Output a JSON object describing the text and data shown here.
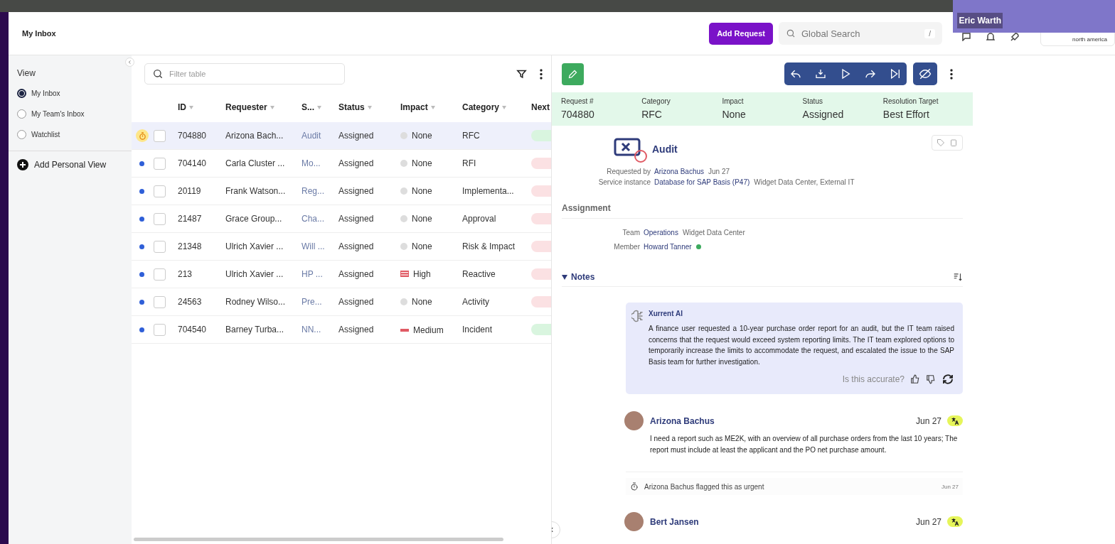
{
  "header": {
    "title": "My Inbox",
    "add_button": "Add Request",
    "search": {
      "placeholder": "Global Search",
      "shortcut": "/"
    },
    "logo_caption": "north america"
  },
  "video_overlay": {
    "name": "Eric Warth"
  },
  "sidebar": {
    "heading": "View",
    "items": [
      {
        "label": "My Inbox",
        "selected": true
      },
      {
        "label": "My Team's Inbox",
        "selected": false
      },
      {
        "label": "Watchlist",
        "selected": false
      }
    ],
    "add_view": "Add Personal View"
  },
  "table": {
    "filter": {
      "placeholder": "Filter table"
    },
    "columns": [
      "ID",
      "Requester",
      "S...",
      "Status",
      "Impact",
      "Category",
      "Next"
    ],
    "rows": [
      {
        "urgent": true,
        "selected": true,
        "id": "704880",
        "requester": "Arizona Bach...",
        "subject": "Audit",
        "status": "Assigned",
        "impact": {
          "kind": "none",
          "label": "None"
        },
        "category": "RFC",
        "color": "#d9f5df"
      },
      {
        "urgent": false,
        "selected": false,
        "id": "704140",
        "requester": "Carla Cluster ...",
        "subject": "Mo...",
        "status": "Assigned",
        "impact": {
          "kind": "none",
          "label": "None"
        },
        "category": "RFI",
        "color": "#fbe1e3"
      },
      {
        "urgent": false,
        "selected": false,
        "id": "20119",
        "requester": "Frank Watson...",
        "subject": "Reg...",
        "status": "Assigned",
        "impact": {
          "kind": "none",
          "label": "None"
        },
        "category": "Implementa...",
        "color": "#fbe1e3"
      },
      {
        "urgent": false,
        "selected": false,
        "id": "21487",
        "requester": "Grace Group...",
        "subject": "Cha...",
        "status": "Assigned",
        "impact": {
          "kind": "none",
          "label": "None"
        },
        "category": "Approval",
        "color": "#fbe1e3"
      },
      {
        "urgent": false,
        "selected": false,
        "id": "21348",
        "requester": "Ulrich Xavier ...",
        "subject": "Will ...",
        "status": "Assigned",
        "impact": {
          "kind": "none",
          "label": "None"
        },
        "category": "Risk & Impact",
        "color": "#fbe1e3"
      },
      {
        "urgent": false,
        "selected": false,
        "id": "213",
        "requester": "Ulrich Xavier ...",
        "subject": "HP ...",
        "status": "Assigned",
        "impact": {
          "kind": "high",
          "label": "High"
        },
        "category": "Reactive",
        "color": "#fbe1e3"
      },
      {
        "urgent": false,
        "selected": false,
        "id": "24563",
        "requester": "Rodney Wilso...",
        "subject": "Pre...",
        "status": "Assigned",
        "impact": {
          "kind": "none",
          "label": "None"
        },
        "category": "Activity",
        "color": "#fbe1e3"
      },
      {
        "urgent": false,
        "selected": false,
        "id": "704540",
        "requester": "Barney Turba...",
        "subject": "NN...",
        "status": "Assigned",
        "impact": {
          "kind": "medium",
          "label": "Medium"
        },
        "category": "Incident",
        "color": "#d9f5df"
      }
    ]
  },
  "detail": {
    "summary": [
      {
        "label": "Request #",
        "value": "704880"
      },
      {
        "label": "Category",
        "value": "RFC"
      },
      {
        "label": "Impact",
        "value": "None"
      },
      {
        "label": "Status",
        "value": "Assigned"
      },
      {
        "label": "Resolution Target",
        "value": "Best Effort"
      }
    ],
    "subject": "Audit",
    "requested_by": {
      "label": "Requested by",
      "name": "Arizona Bachus",
      "date": "Jun 27"
    },
    "service_instance": {
      "label": "Service instance",
      "name": "Database for SAP Basis (P47)",
      "detail": "Widget Data Center, External IT"
    },
    "assignment": {
      "heading": "Assignment",
      "team_label": "Team",
      "team": "Operations",
      "team_detail": "Widget Data Center",
      "member_label": "Member",
      "member": "Howard Tanner",
      "member_online": true
    },
    "notes": {
      "heading": "Notes",
      "expanded": true,
      "ai_summary": {
        "author": "Xurrent AI",
        "text": "A finance user requested a 10-year purchase order report for an audit, but the IT team raised concerns that the request would exceed system reporting limits. The IT team explored options to temporarily increase the limits to accommodate the request, and escalated the issue to the SAP Basis team for further investigation.",
        "feedback_prompt": "Is this accurate?"
      },
      "entries": [
        {
          "kind": "note",
          "author": "Arizona Bachus",
          "date": "Jun 27",
          "text": "I need a report such as ME2K, with an overview of all purchase orders from the last 10 years; The report must include at least the applicant and the PO net purchase amount."
        },
        {
          "kind": "event",
          "text": "Arizona Bachus flagged this as urgent",
          "date": "Jun 27"
        },
        {
          "kind": "note",
          "author": "Bert Jansen",
          "date": "Jun 27"
        }
      ]
    }
  }
}
